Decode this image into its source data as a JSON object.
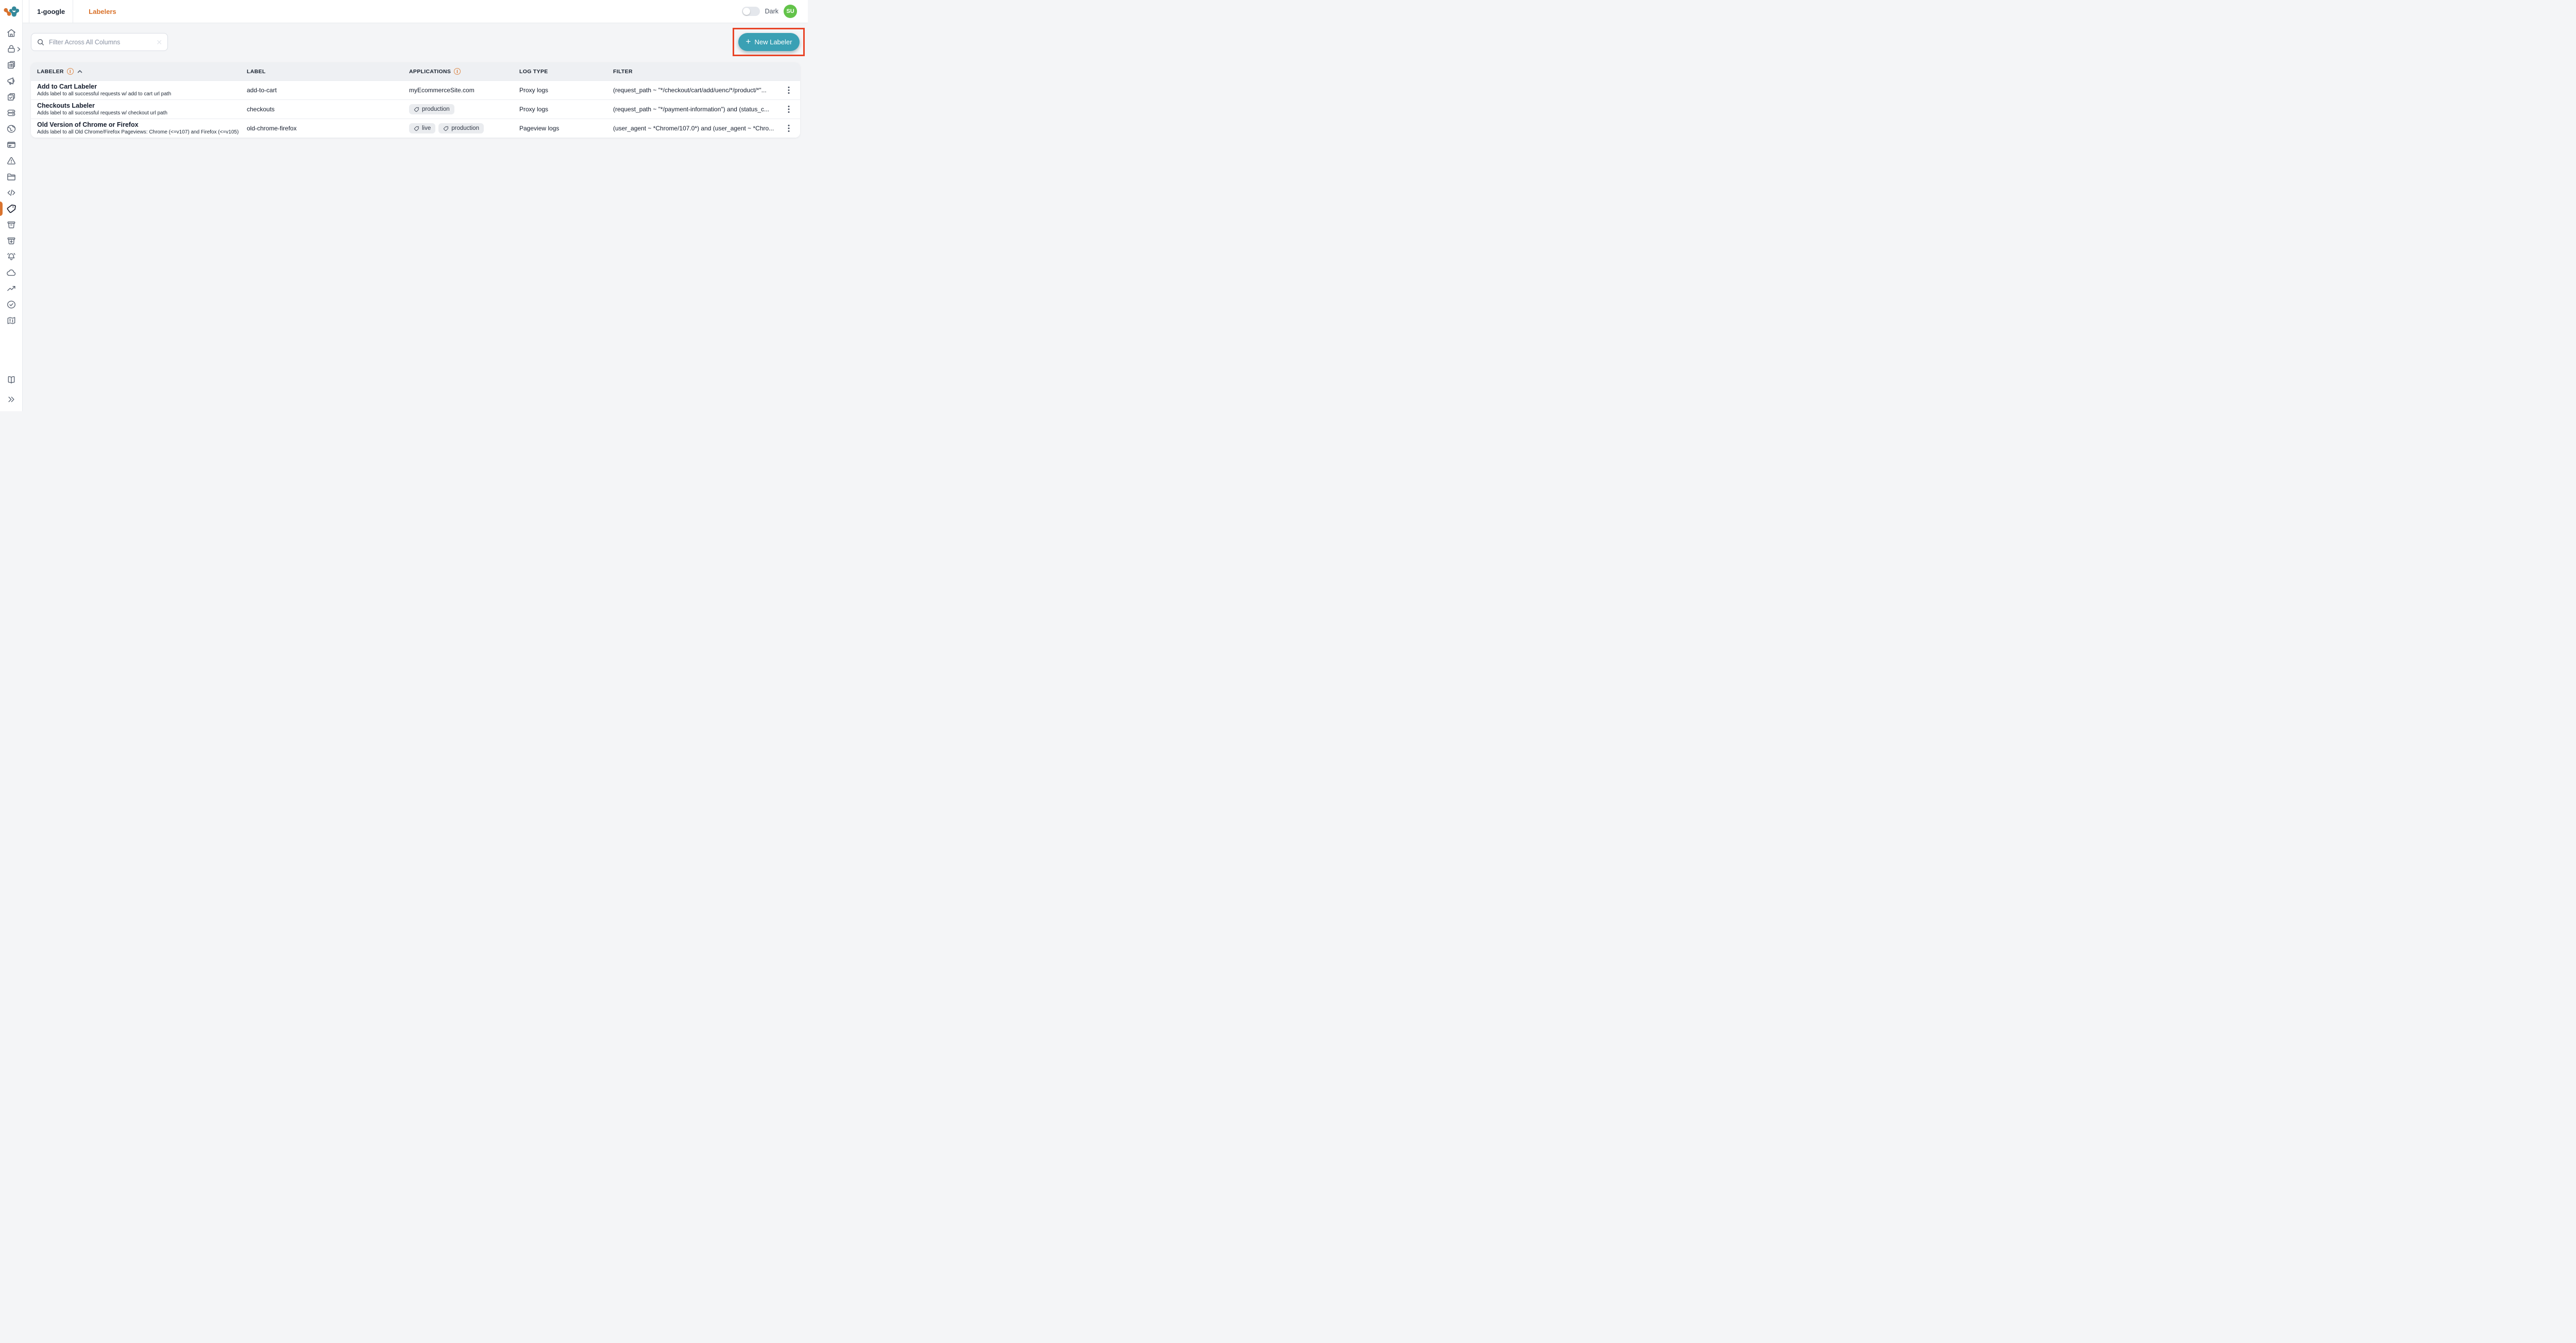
{
  "topbar": {
    "workspace_tab": "1-google",
    "page_title": "Labelers",
    "theme_label": "Dark",
    "avatar_initials": "SU"
  },
  "toolbar": {
    "filter_placeholder": "Filter Across All Columns",
    "new_labeler_label": "New Labeler",
    "new_labeler_plus": "+"
  },
  "colors": {
    "accent_orange": "#d9722b",
    "annotation_red": "#e84326",
    "button_teal": "#3aa0b4",
    "avatar_green": "#63c34a"
  },
  "sidebar": {
    "items": [
      "home",
      "lock",
      "pages",
      "megaphone",
      "tasks",
      "servers",
      "globe",
      "card",
      "alerts",
      "folder",
      "code",
      "labelers",
      "box",
      "inbox",
      "bell",
      "cloud",
      "trends",
      "checks",
      "map"
    ],
    "bottom_items": [
      "docs",
      "expand"
    ],
    "active_item": "labelers"
  },
  "table": {
    "headers": [
      {
        "label": "LABELER",
        "info": true,
        "sort": "asc"
      },
      {
        "label": "LABEL",
        "info": false
      },
      {
        "label": "APPLICATIONS",
        "info": true
      },
      {
        "label": "LOG TYPE",
        "info": false
      },
      {
        "label": "FILTER",
        "info": false
      }
    ],
    "rows": [
      {
        "name": "Add to Cart Labeler",
        "description": "Adds label to all successful requests w/ add to cart url path",
        "label": "add-to-cart",
        "applications_text": "myEcommerceSite.com",
        "applications_tags": [],
        "log_type": "Proxy logs",
        "filter": "(request_path ~ \"*/checkout/cart/add/uenc/*/product/*\"..."
      },
      {
        "name": "Checkouts Labeler",
        "description": "Adds label to all successful requests w/ checkout url path",
        "label": "checkouts",
        "applications_text": "",
        "applications_tags": [
          "production"
        ],
        "log_type": "Proxy logs",
        "filter": "(request_path ~ \"*/payment-information\") and (status_c..."
      },
      {
        "name": "Old Version of Chrome or Firefox",
        "description": "Adds label to all Old Chrome/Firefox Pageviews: Chrome (<=v107) and Firefox (<=v105)",
        "label": "old-chrome-firefox",
        "applications_text": "",
        "applications_tags": [
          "live",
          "production"
        ],
        "log_type": "Pageview logs",
        "filter": "(user_agent ~ *Chrome/107.0*) and (user_agent ~ *Chro..."
      }
    ]
  }
}
